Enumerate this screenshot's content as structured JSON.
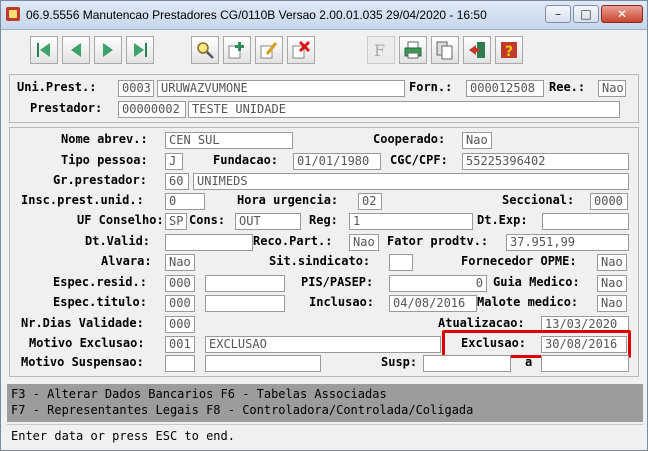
{
  "window": {
    "title": "06.9.5556 Manutencao  Prestadores CG/0110B Versao 2.00.01.035 29/04/2020 - 16:50",
    "min_glyph": "–",
    "max_glyph": "□",
    "close_glyph": "✕"
  },
  "toolbar": {
    "icons": [
      "first-record-icon",
      "previous-record-icon",
      "next-record-icon",
      "last-record-icon",
      "search-icon",
      "add-icon",
      "edit-icon",
      "delete-icon",
      "filter-icon",
      "print-icon",
      "copy-icon",
      "exit-icon",
      "help-icon"
    ]
  },
  "header": {
    "uni_prest_label": "Uni.Prest.:",
    "uni_prest_code": "0003",
    "uni_prest_name": "URUWAZVUMONE",
    "forn_label": "Forn.:",
    "forn_value": "000012508",
    "ree_label": "Ree.:",
    "ree_value": "Nao",
    "prestador_label": "Prestador:",
    "prestador_code": "00000002",
    "prestador_name": "TESTE UNIDADE"
  },
  "form": {
    "nome_abrev_label": "Nome abrev.:",
    "nome_abrev": "CEN SUL",
    "cooperado_label": "Cooperado:",
    "cooperado": "Nao",
    "tipo_pessoa_label": "Tipo pessoa:",
    "tipo_pessoa": "J",
    "fundacao_label": "Fundacao:",
    "fundacao": "01/01/1980",
    "cgc_label": "CGC/CPF:",
    "cgc": "55225396402",
    "gr_prestador_label": "Gr.prestador:",
    "gr_prestador_code": "60",
    "gr_prestador_name": "UNIMEDS",
    "insc_label": "Insc.prest.unid.:",
    "insc": "0",
    "hora_urgencia_label": "Hora urgencia:",
    "hora_urgencia": "02",
    "seccional_label": "Seccional:",
    "seccional": "0000",
    "uf_conselho_label": "UF Conselho:",
    "uf_conselho": "SP",
    "cons_label": "Cons:",
    "cons": "OUT",
    "reg_label": "Reg:",
    "reg": "1",
    "dt_exp_label": "Dt.Exp:",
    "dt_exp": "",
    "dt_valid_label": "Dt.Valid:",
    "dt_valid": "",
    "reco_part_label": "Reco.Part.:",
    "reco_part": "Nao",
    "fator_label": "Fator prodtv.:",
    "fator": "37.951,99",
    "alvara_label": "Alvara:",
    "alvara": "Nao",
    "sit_sindicato_label": "Sit.sindicato:",
    "sit_sindicato": "",
    "fornecedor_opme_label": "Fornecedor OPME:",
    "fornecedor_opme": "Nao",
    "espec_resid_label": "Espec.resid.:",
    "espec_resid_code": "000",
    "espec_resid_desc": "",
    "pis_label": "PIS/PASEP:",
    "pis": "0",
    "guia_medico_label": "Guia Medico:",
    "guia_medico": "Nao",
    "espec_titulo_label": "Espec.titulo:",
    "espec_titulo_code": "000",
    "espec_titulo_desc": "",
    "inclusao_label": "Inclusao:",
    "inclusao": "04/08/2016",
    "malote_label": "Malote medico:",
    "malote": "Nao",
    "nr_dias_label": "Nr.Dias Validade:",
    "nr_dias": "000",
    "atualizacao_label": "Atualizacao:",
    "atualizacao": "13/03/2020",
    "motivo_exclusao_label": "Motivo Exclusao:",
    "motivo_exclusao_code": "001",
    "motivo_exclusao_desc": "EXCLUSAO",
    "exclusao_label": "Exclusao:",
    "exclusao": "30/08/2016",
    "motivo_suspensao_label": "Motivo Suspensao:",
    "motivo_suspensao_code": "",
    "motivo_suspensao_desc": "",
    "susp_label": "Susp:",
    "susp": "",
    "a_label": "a",
    "susp_ate": ""
  },
  "function_keys": {
    "line1": "F3 - Alterar Dados Bancarios  F6 - Tabelas Associadas",
    "line2": "F7 - Representantes Legais  F8 - Controladora/Controlada/Coligada"
  },
  "status_bar": {
    "text": "Enter data or press ESC to end."
  },
  "colors": {
    "highlight_border": "#e00000",
    "function_key_bar": "#9c9c9c",
    "close_button": "#c8452e"
  }
}
